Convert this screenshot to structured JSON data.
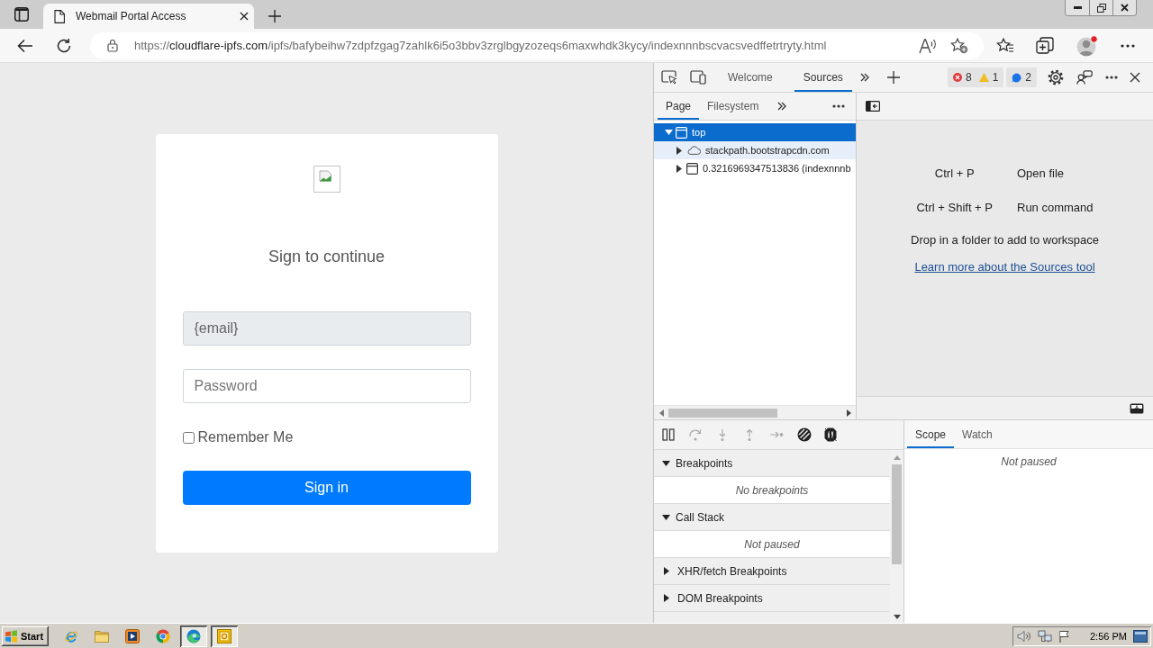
{
  "browser": {
    "tabs": [
      {
        "title": "Webmail Portal Access",
        "selected": true
      }
    ],
    "address": {
      "scheme": "https://",
      "host": "cloudflare-ipfs.com",
      "path": "/ipfs/bafybeihw7zdpfzgag7zahlk6i5o3bbv3zrglbgyzozeqs6maxwhdk3kycy/indexnnnbscvacsvedffetrtryty.html"
    }
  },
  "page": {
    "heading": "Sign to continue",
    "email_field": {
      "value": "{email}",
      "disabled": true
    },
    "password_field": {
      "placeholder": "Password"
    },
    "remember_me": {
      "label": "Remember Me",
      "checked": false
    },
    "submit_button": "Sign in"
  },
  "devtools": {
    "tabs": [
      {
        "label": "Welcome",
        "selected": false
      },
      {
        "label": "Sources",
        "selected": true
      }
    ],
    "issues": {
      "errors": "8",
      "warnings": "1",
      "messages": "2"
    },
    "navigator": {
      "tabs": [
        {
          "label": "Page",
          "selected": true
        },
        {
          "label": "Filesystem",
          "selected": false
        }
      ],
      "tree": [
        {
          "label": "top",
          "kind": "frame",
          "expanded": true,
          "selected": true,
          "highlighted": false,
          "children": [
            {
              "label": "stackpath.bootstrapcdn.com",
              "kind": "domain",
              "expanded": false,
              "selected": false,
              "highlighted": true
            },
            {
              "label": "0.3216969347513836 (indexnnnb",
              "kind": "frame",
              "expanded": false,
              "selected": false,
              "highlighted": false
            }
          ]
        }
      ]
    },
    "editor": {
      "shortcuts": [
        {
          "keys": "Ctrl + P",
          "action": "Open file"
        },
        {
          "keys": "Ctrl + Shift + P",
          "action": "Run command"
        }
      ],
      "hint": "Drop in a folder to add to workspace",
      "link": "Learn more about the Sources tool"
    },
    "debugger": {
      "paused": false,
      "sections": [
        {
          "title": "Breakpoints",
          "expanded": true,
          "message": "No breakpoints"
        },
        {
          "title": "Call Stack",
          "expanded": true,
          "message": "Not paused"
        },
        {
          "title": "XHR/fetch Breakpoints",
          "expanded": false
        },
        {
          "title": "DOM Breakpoints",
          "expanded": false
        }
      ]
    },
    "sidebar": {
      "tabs": [
        {
          "label": "Scope",
          "selected": true
        },
        {
          "label": "Watch",
          "selected": false
        }
      ],
      "message": "Not paused"
    }
  },
  "taskbar": {
    "start": "Start",
    "apps": [
      {
        "kind": "ie",
        "active": false
      },
      {
        "kind": "folder",
        "active": false
      },
      {
        "kind": "media",
        "active": false
      },
      {
        "kind": "chrome",
        "active": false
      },
      {
        "kind": "edge",
        "active": true
      },
      {
        "kind": "notes",
        "active": true
      }
    ],
    "clock": "2:56 PM"
  }
}
